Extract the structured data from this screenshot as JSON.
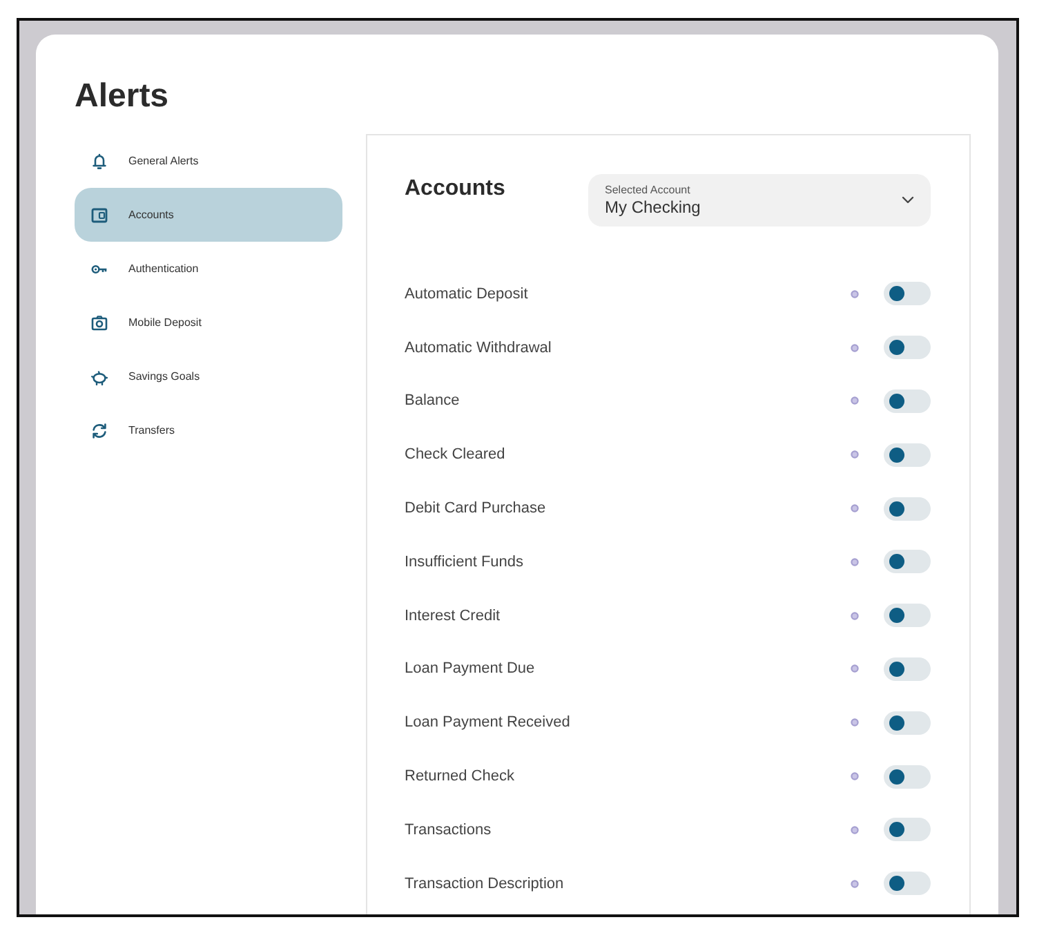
{
  "page": {
    "title": "Alerts"
  },
  "sidebar": {
    "items": [
      {
        "label": "General Alerts",
        "selected": false
      },
      {
        "label": "Accounts",
        "selected": true
      },
      {
        "label": "Authentication",
        "selected": false
      },
      {
        "label": "Mobile Deposit",
        "selected": false
      },
      {
        "label": "Savings Goals",
        "selected": false
      },
      {
        "label": "Transfers",
        "selected": false
      }
    ]
  },
  "panel": {
    "title": "Accounts",
    "account_select": {
      "label": "Selected Account",
      "value": "My Checking"
    },
    "alerts": [
      {
        "label": "Automatic Deposit",
        "on": false
      },
      {
        "label": "Automatic Withdrawal",
        "on": false
      },
      {
        "label": "Balance",
        "on": false
      },
      {
        "label": "Check Cleared",
        "on": false
      },
      {
        "label": "Debit Card Purchase",
        "on": false
      },
      {
        "label": "Insufficient Funds",
        "on": false
      },
      {
        "label": "Interest Credit",
        "on": false
      },
      {
        "label": "Loan Payment Due",
        "on": false
      },
      {
        "label": "Loan Payment Received",
        "on": false
      },
      {
        "label": "Returned Check",
        "on": false
      },
      {
        "label": "Transactions",
        "on": false
      },
      {
        "label": "Transaction Description",
        "on": false
      }
    ]
  }
}
